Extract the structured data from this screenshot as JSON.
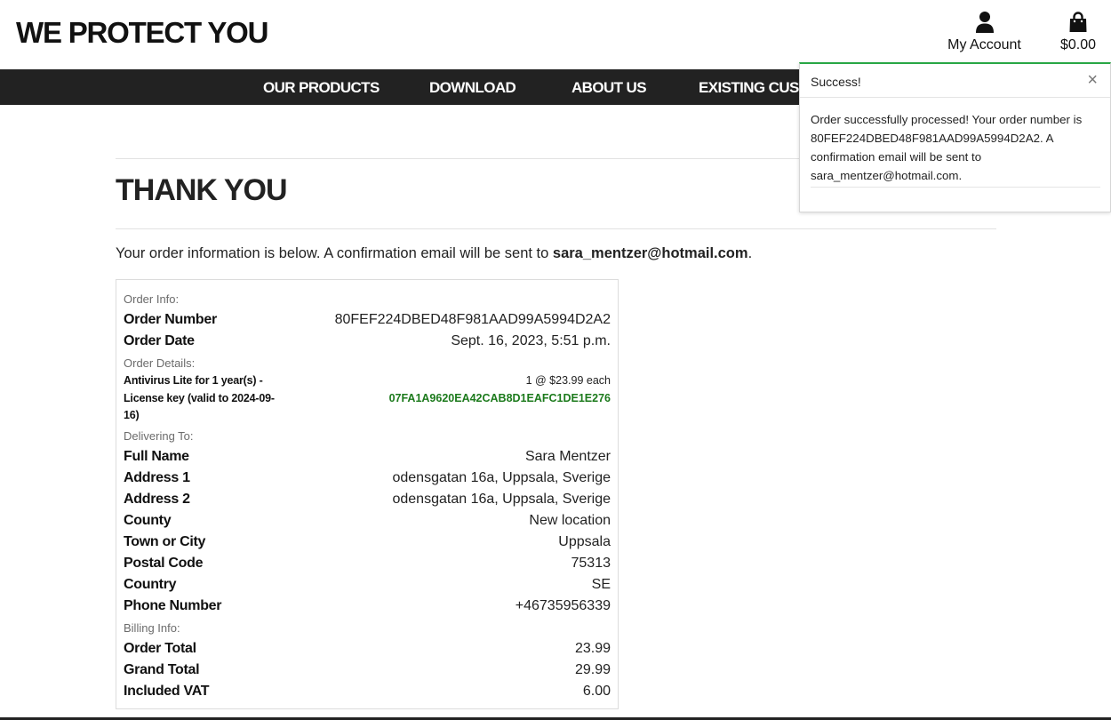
{
  "brand": "WE PROTECT YOU",
  "header": {
    "account_label": "My Account",
    "bag_label": "$0.00",
    "account_icon": "user-icon",
    "bag_icon": "shopping-bag-icon"
  },
  "nav": {
    "items": [
      "OUR PRODUCTS",
      "DOWNLOAD",
      "ABOUT US",
      "EXISTING CUSTOMERS"
    ]
  },
  "page": {
    "title": "THANK YOU",
    "intro_text": "Your order information is below. A confirmation email will be sent to ",
    "intro_email": "sara_mentzer@hotmail.com",
    "intro_end": "."
  },
  "order": {
    "section_info": "Order Info:",
    "order_number_label": "Order Number",
    "order_number": "80FEF224DBED48F981AAD99A5994D2A2",
    "order_date_label": "Order Date",
    "order_date": "Sept. 16, 2023, 5:51 p.m.",
    "section_details": "Order Details:",
    "item_name": "Antivirus Lite for 1 year(s) - License key (valid to 2024-09-16)",
    "item_qty": "1 @ $23.99 each",
    "item_key": "07FA1A9620EA42CAB8D1EAFC1DE1E276",
    "section_delivery": "Delivering To:",
    "delivery": [
      {
        "label": "Full Name",
        "value": "Sara Mentzer"
      },
      {
        "label": "Address 1",
        "value": "odensgatan 16a, Uppsala, Sverige"
      },
      {
        "label": "Address 2",
        "value": "odensgatan 16a, Uppsala, Sverige"
      },
      {
        "label": "County",
        "value": "New location"
      },
      {
        "label": "Town or City",
        "value": "Uppsala"
      },
      {
        "label": "Postal Code",
        "value": "75313"
      },
      {
        "label": "Country",
        "value": "SE"
      },
      {
        "label": "Phone Number",
        "value": "+46735956339"
      }
    ],
    "section_billing": "Billing Info:",
    "billing": [
      {
        "label": "Order Total",
        "value": "23.99"
      },
      {
        "label": "Grand Total",
        "value": "29.99"
      },
      {
        "label": "Included VAT",
        "value": "6.00"
      }
    ]
  },
  "toast": {
    "title": "Success!",
    "close": "×",
    "message": "Order successfully processed! Your order number is 80FEF224DBED48F981AAD99A5994D2A2. A confirmation email will be sent to sara_mentzer@hotmail.com.",
    "accent_color": "#28a745"
  }
}
